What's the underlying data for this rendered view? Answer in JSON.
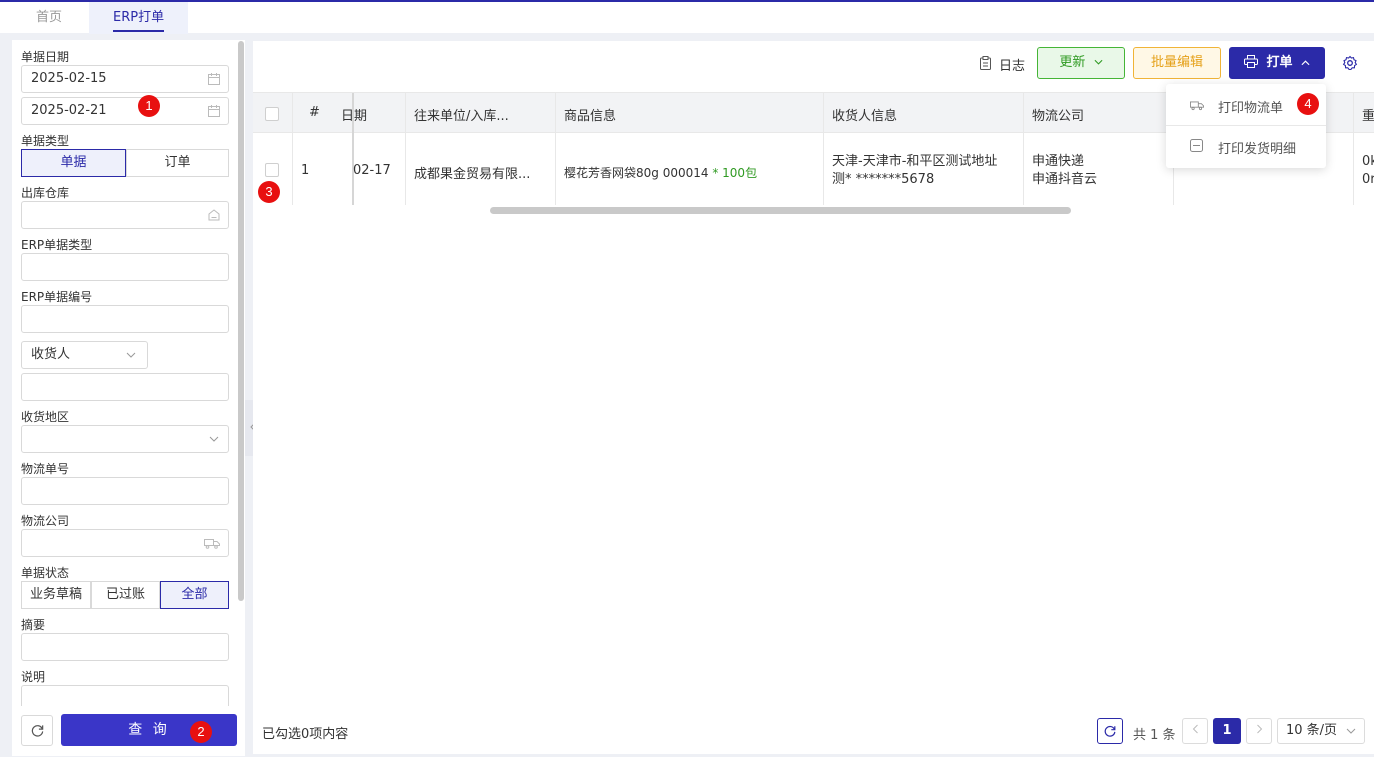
{
  "tabs": [
    {
      "label": "首页"
    },
    {
      "label": "ERP打单"
    }
  ],
  "filters": {
    "doc_date_label": "单据日期",
    "date_start": "2025-02-15",
    "date_end": "2025-02-21",
    "doc_type_label": "单据类型",
    "doc_type_options": [
      "单据",
      "订单"
    ],
    "warehouse_label": "出库仓库",
    "erp_doc_type_label": "ERP单据类型",
    "erp_doc_no_label": "ERP单据编号",
    "receiver_select": "收货人",
    "region_label": "收货地区",
    "tracking_no_label": "物流单号",
    "logistics_label": "物流公司",
    "status_label": "单据状态",
    "status_options": [
      "业务草稿",
      "已过账",
      "全部"
    ],
    "summary_label": "摘要",
    "note_label": "说明",
    "query_label": "查 询"
  },
  "toolbar": {
    "log_label": "日志",
    "update_label": "更新",
    "batch_edit_label": "批量编辑",
    "print_label": "打单"
  },
  "print_menu": [
    {
      "label": "打印物流单"
    },
    {
      "label": "打印发货明细"
    }
  ],
  "table": {
    "headers": [
      "#",
      "日期",
      "往来单位/入库...",
      "商品信息",
      "收货人信息",
      "物流公司",
      "重"
    ],
    "rows": [
      {
        "index": "1",
        "date": "02-17",
        "partner": "成都果金贸易有限...",
        "product": "樱花芳香网袋80g 000014",
        "qty": "* 100包",
        "receiver_line1": "天津-天津市-和平区测试地址",
        "receiver_line2": "测* *******5678",
        "logistics_line1": "申通快递",
        "logistics_line2": "申通抖音云",
        "weight_line1": "0k",
        "weight_line2": "0r"
      }
    ]
  },
  "footer": {
    "selected_text": "已勾选0项内容",
    "total_text": "共 1 条",
    "current_page": "1",
    "page_size": "10 条/页"
  },
  "annotations": [
    "1",
    "2",
    "3",
    "4"
  ]
}
